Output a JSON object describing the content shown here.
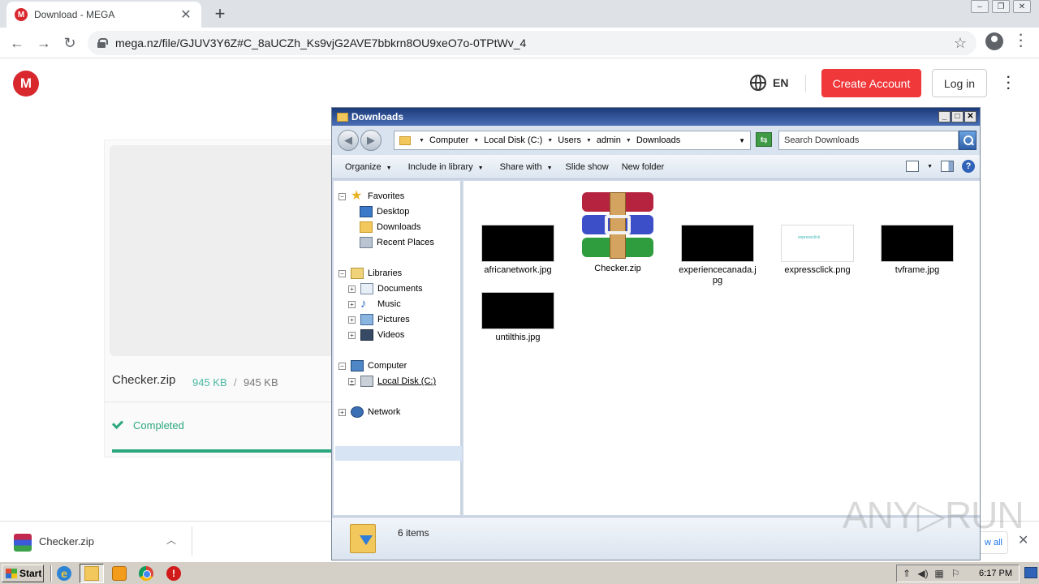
{
  "browser": {
    "tab_title": "Download - MEGA",
    "tab_favicon": "M",
    "tab_close": "✕",
    "new_tab": "+",
    "url": "mega.nz/file/GJUV3Y6Z#C_8aUCZh_Ks9vjG2AVE7bbkrn8OU9xeO7o-0TPtWv_4",
    "back": "←",
    "forward": "→",
    "reload": "↻",
    "star": "☆",
    "menu": "⋮"
  },
  "mega": {
    "logo": "M",
    "lang": "EN",
    "create_account": "Create Account",
    "login": "Log in",
    "more": "⋮",
    "file_name": "Checker.zip",
    "downloaded": "945 KB",
    "separator": "/",
    "total": "945 KB",
    "status": "Completed",
    "progress_percent": 100
  },
  "download_bar": {
    "file_name": "Checker.zip",
    "chevron": "︿",
    "show_all": "w all",
    "close": "✕"
  },
  "explorer": {
    "title": "Downloads",
    "breadcrumb": [
      "Computer",
      "Local Disk (C:)",
      "Users",
      "admin",
      "Downloads"
    ],
    "search_placeholder": "Search Downloads",
    "commands": {
      "organize": "Organize",
      "include_in_library": "Include in library",
      "share_with": "Share with",
      "slide_show": "Slide show",
      "new_folder": "New folder"
    },
    "nav": {
      "favorites": "Favorites",
      "desktop": "Desktop",
      "downloads": "Downloads",
      "recent_places": "Recent Places",
      "libraries": "Libraries",
      "documents": "Documents",
      "music": "Music",
      "pictures": "Pictures",
      "videos": "Videos",
      "computer": "Computer",
      "local_disk": "Local Disk (C:)",
      "network": "Network"
    },
    "files": [
      {
        "name": "africanetwork.jpg"
      },
      {
        "name": "Checker.zip"
      },
      {
        "name": "experiencecanada.jpg"
      },
      {
        "name": "expressclick.png",
        "thumb_text": "expressclick"
      },
      {
        "name": "tvframe.jpg"
      },
      {
        "name": "untilthis.jpg"
      }
    ],
    "item_count": "6 items"
  },
  "taskbar": {
    "start": "Start",
    "clock": "6:17 PM"
  },
  "watermark": "ANY▷RUN"
}
